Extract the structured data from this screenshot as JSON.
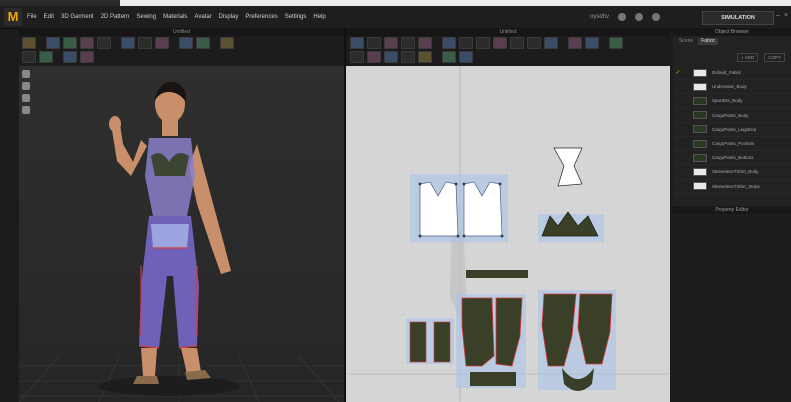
{
  "app": {
    "logo": "M",
    "menu": [
      "File",
      "Edit",
      "3D Garment",
      "2D Pattern",
      "Sewing",
      "Materials",
      "Avatar",
      "Display",
      "Preferences",
      "Settings",
      "Help"
    ],
    "user": "oysdhv",
    "mode": "SIMULATION"
  },
  "panels": {
    "view3d_title": "Untitled",
    "view2d_title": "Untitled",
    "object_browser": "Object Browser",
    "property_editor": "Property Editor"
  },
  "object_browser": {
    "tabs": [
      "Scene",
      "Fabric"
    ],
    "active_tab": "Fabric",
    "actions": [
      "+ ADD",
      "COPY"
    ],
    "fabrics": [
      {
        "name": "Default_Fabric",
        "color": "#e8e8e8",
        "checked": true
      },
      {
        "name": "Underwear_Body",
        "color": "#e8e8e8",
        "checked": false
      },
      {
        "name": "SportBra_Body",
        "color": "#2a3a20",
        "checked": false
      },
      {
        "name": "CargoPants_Body",
        "color": "#2a3a20",
        "checked": false
      },
      {
        "name": "CargoPants_LegsEnd",
        "color": "#2a3a20",
        "checked": false
      },
      {
        "name": "CargoPants_Pockets",
        "color": "#2a3a20",
        "checked": false
      },
      {
        "name": "CargoPants_Buttons",
        "color": "#2a3a20",
        "checked": false
      },
      {
        "name": "SleevelessTShirt_Body",
        "color": "#e8e8e8",
        "checked": false
      },
      {
        "name": "SleevelessTShirt_Strips",
        "color": "#e8e8e8",
        "checked": false
      }
    ]
  },
  "colors": {
    "accent": "#f0a500",
    "pattern_dark": "#3a4028",
    "pattern_outline": "#6fa3e0",
    "stitch": "#d43a3a",
    "mesh_purple": "#6a5acd"
  }
}
